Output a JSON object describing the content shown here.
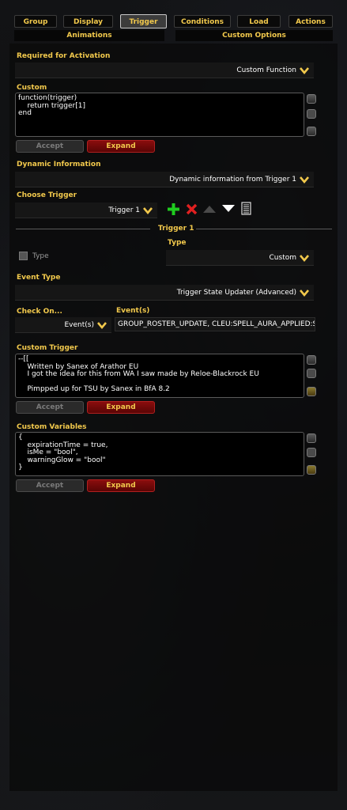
{
  "tabs": [
    "Group",
    "Display",
    "Trigger",
    "Conditions",
    "Load",
    "Actions"
  ],
  "active_tab": "Trigger",
  "sub_tabs": [
    "Animations",
    "Custom Options"
  ],
  "required_activation": {
    "label": "Required for Activation",
    "value": "Custom Function"
  },
  "custom": {
    "label": "Custom",
    "code": "function(trigger)\n    return trigger[1]\nend",
    "accept": "Accept",
    "expand": "Expand"
  },
  "dynamic_info": {
    "label": "Dynamic Information",
    "value": "Dynamic information from Trigger 1"
  },
  "choose_trigger": {
    "label": "Choose Trigger",
    "value": "Trigger 1"
  },
  "trigger_header": "Trigger 1",
  "type_checkbox": "Type",
  "type": {
    "label": "Type",
    "value": "Custom"
  },
  "event_type": {
    "label": "Event Type",
    "value": "Trigger State Updater (Advanced)"
  },
  "check_on": {
    "label": "Check On...",
    "value": "Event(s)"
  },
  "events": {
    "label": "Event(s)",
    "value": "GROUP_ROSTER_UPDATE, CLEU:SPELL_AURA_APPLIED:S"
  },
  "custom_trigger": {
    "label": "Custom Trigger",
    "code": "--[[\n    Written by Sanex of Arathor EU\n    I got the idea for this from WA I saw made by Reloe-Blackrock EU\n\n    Pimpped up for TSU by Sanex in BfA 8.2",
    "accept": "Accept",
    "expand": "Expand"
  },
  "custom_variables": {
    "label": "Custom Variables",
    "code": "{\n    expirationTime = true,\n    isMe = \"bool\",\n    warningGlow = \"bool\"\n}",
    "accept": "Accept",
    "expand": "Expand"
  },
  "colors": {
    "gold": "#f2c94c",
    "expand_red": "#8a0d0d",
    "add_green": "#1fcc1f",
    "delete_red": "#e02020"
  }
}
